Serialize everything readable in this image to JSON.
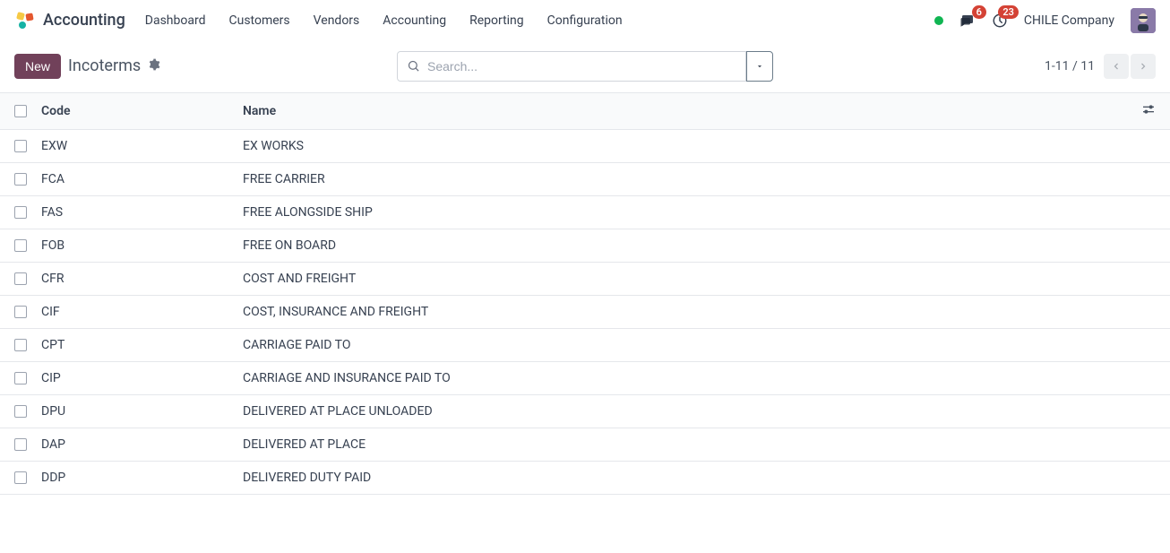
{
  "header": {
    "app_title": "Accounting",
    "menu": [
      "Dashboard",
      "Customers",
      "Vendors",
      "Accounting",
      "Reporting",
      "Configuration"
    ],
    "messages_badge": "6",
    "activities_badge": "23",
    "company": "CHILE Company"
  },
  "controlbar": {
    "new_button": "New",
    "breadcrumb": "Incoterms",
    "search_placeholder": "Search..."
  },
  "pager": {
    "range": "1-11",
    "sep": " / ",
    "total": "11"
  },
  "table": {
    "columns": {
      "code": "Code",
      "name": "Name"
    },
    "rows": [
      {
        "code": "EXW",
        "name": "EX WORKS"
      },
      {
        "code": "FCA",
        "name": "FREE CARRIER"
      },
      {
        "code": "FAS",
        "name": "FREE ALONGSIDE SHIP"
      },
      {
        "code": "FOB",
        "name": "FREE ON BOARD"
      },
      {
        "code": "CFR",
        "name": "COST AND FREIGHT"
      },
      {
        "code": "CIF",
        "name": "COST, INSURANCE AND FREIGHT"
      },
      {
        "code": "CPT",
        "name": "CARRIAGE PAID TO"
      },
      {
        "code": "CIP",
        "name": "CARRIAGE AND INSURANCE PAID TO"
      },
      {
        "code": "DPU",
        "name": "DELIVERED AT PLACE UNLOADED"
      },
      {
        "code": "DAP",
        "name": "DELIVERED AT PLACE"
      },
      {
        "code": "DDP",
        "name": "DELIVERED DUTY PAID"
      }
    ]
  }
}
